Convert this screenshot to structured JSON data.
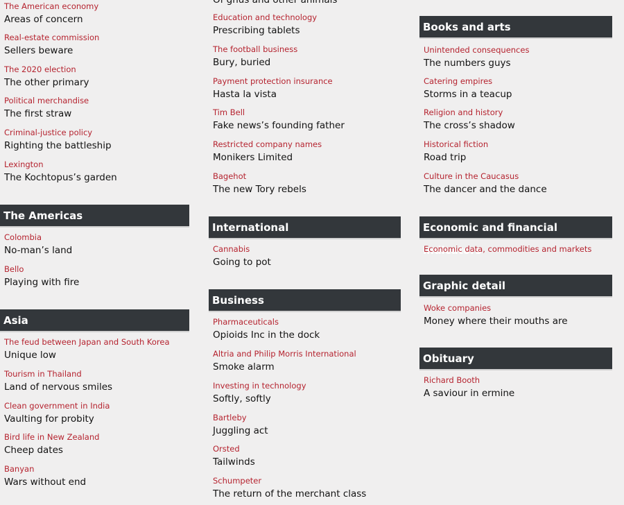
{
  "colors": {
    "background": "#f0efef",
    "kicker": "#b5232f",
    "header_bg": "#33373b"
  },
  "columns": [
    {
      "blocks": [
        {
          "items": [
            {
              "kicker": "The American economy",
              "title": "Areas of concern"
            },
            {
              "kicker": "Real-estate commission",
              "title": "Sellers beware"
            },
            {
              "kicker": "The 2020 election",
              "title": "The other primary"
            },
            {
              "kicker": "Political merchandise",
              "title": "The first straw"
            },
            {
              "kicker": "Criminal-justice policy",
              "title": "Righting the battleship"
            },
            {
              "kicker": "Lexington",
              "title": "The Kochtopus’s garden"
            }
          ]
        },
        {
          "header": "The Americas",
          "items": [
            {
              "kicker": "Colombia",
              "title": "No-man’s land"
            },
            {
              "kicker": "Bello",
              "title": "Playing with fire"
            }
          ]
        },
        {
          "header": "Asia",
          "items": [
            {
              "kicker": "The feud between Japan and South Korea",
              "title": "Unique low"
            },
            {
              "kicker": "Tourism in Thailand",
              "title": "Land of nervous smiles"
            },
            {
              "kicker": "Clean government in India",
              "title": "Vaulting for probity"
            },
            {
              "kicker": "Bird life in New Zealand",
              "title": "Cheep dates"
            },
            {
              "kicker": "Banyan",
              "title": "Wars without end"
            }
          ]
        }
      ]
    },
    {
      "blocks": [
        {
          "items": [
            {
              "kicker": "",
              "title": "Of gnus and other animals"
            },
            {
              "kicker": "Education and technology",
              "title": "Prescribing tablets"
            },
            {
              "kicker": "The football business",
              "title": "Bury, buried"
            },
            {
              "kicker": "Payment protection insurance",
              "title": "Hasta la vista"
            },
            {
              "kicker": "Tim Bell",
              "title": "Fake news’s founding father"
            },
            {
              "kicker": "Restricted company names",
              "title": "Monikers Limited"
            },
            {
              "kicker": "Bagehot",
              "title": "The new Tory rebels"
            }
          ]
        },
        {
          "header": "International",
          "items": [
            {
              "kicker": "Cannabis",
              "title": "Going to pot"
            }
          ]
        },
        {
          "header": "Business",
          "items": [
            {
              "kicker": "Pharmaceuticals",
              "title": "Opioids Inc in the dock"
            },
            {
              "kicker": "Altria and Philip Morris International",
              "title": "Smoke alarm"
            },
            {
              "kicker": "Investing in technology",
              "title": "Softly, softly"
            },
            {
              "kicker": "Bartleby",
              "title": "Juggling act"
            },
            {
              "kicker": "Orsted",
              "title": "Tailwinds"
            },
            {
              "kicker": "Schumpeter",
              "title": "The return of the merchant class"
            }
          ]
        }
      ]
    },
    {
      "blocks": [
        {
          "header": "Books and arts",
          "items": [
            {
              "kicker": "Unintended consequences",
              "title": "The numbers guys"
            },
            {
              "kicker": "Catering empires",
              "title": "Storms in a teacup"
            },
            {
              "kicker": "Religion and history",
              "title": "The cross’s shadow"
            },
            {
              "kicker": "Historical fiction",
              "title": "Road trip"
            },
            {
              "kicker": "Culture in the Caucasus",
              "title": "The dancer and the dance"
            }
          ]
        },
        {
          "header": "Economic and financial indicators",
          "items": [
            {
              "kicker": "Economic data, commodities and markets",
              "title": ""
            }
          ]
        },
        {
          "header": "Graphic detail",
          "items": [
            {
              "kicker": "Woke companies",
              "title": "Money where their mouths are"
            }
          ]
        },
        {
          "header": "Obituary",
          "items": [
            {
              "kicker": "Richard Booth",
              "title": "A saviour in ermine"
            }
          ]
        }
      ]
    }
  ]
}
